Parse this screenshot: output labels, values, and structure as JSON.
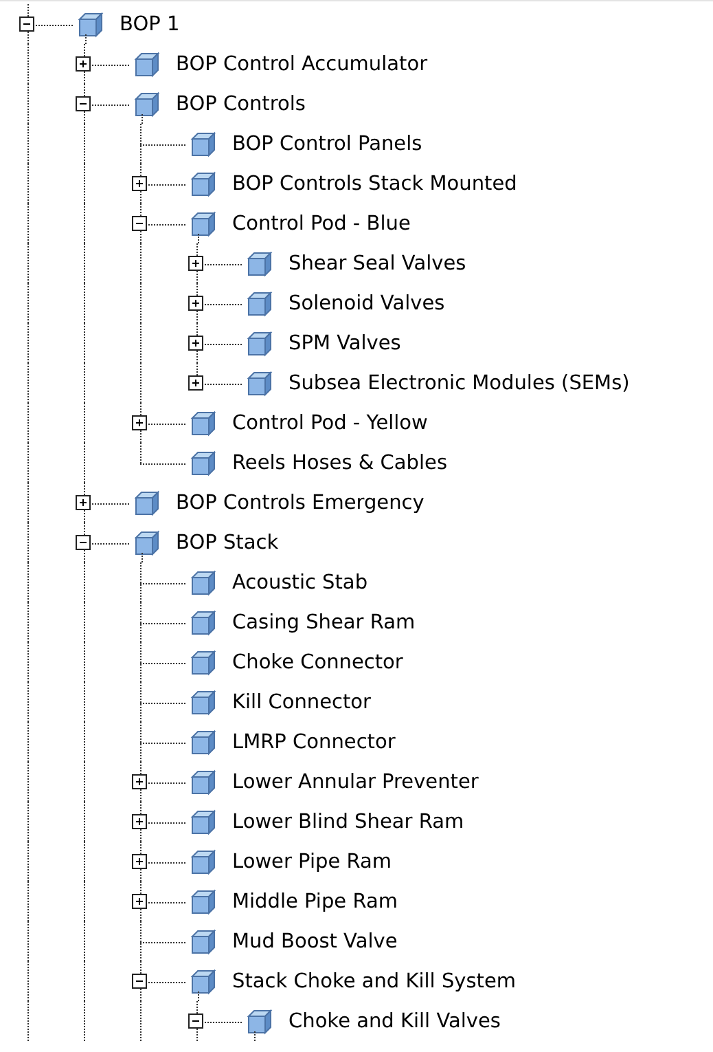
{
  "tree": [
    {
      "label": "BOP 1",
      "expanded": true,
      "children": [
        {
          "label": "BOP Control Accumulator",
          "expanded": false
        },
        {
          "label": "BOP Controls",
          "expanded": true,
          "children": [
            {
              "label": "BOP Control Panels"
            },
            {
              "label": "BOP Controls Stack Mounted",
              "expanded": false
            },
            {
              "label": "Control Pod - Blue",
              "expanded": true,
              "children": [
                {
                  "label": "Shear Seal Valves",
                  "expanded": false
                },
                {
                  "label": "Solenoid Valves",
                  "expanded": false
                },
                {
                  "label": "SPM Valves",
                  "expanded": false
                },
                {
                  "label": "Subsea Electronic Modules (SEMs)",
                  "expanded": false
                }
              ]
            },
            {
              "label": "Control Pod - Yellow",
              "expanded": false
            },
            {
              "label": "Reels Hoses & Cables"
            }
          ]
        },
        {
          "label": "BOP Controls Emergency",
          "expanded": false
        },
        {
          "label": "BOP Stack",
          "expanded": true,
          "children": [
            {
              "label": "Acoustic Stab"
            },
            {
              "label": "Casing Shear Ram"
            },
            {
              "label": "Choke Connector"
            },
            {
              "label": "Kill Connector"
            },
            {
              "label": "LMRP Connector"
            },
            {
              "label": "Lower Annular Preventer",
              "expanded": false
            },
            {
              "label": "Lower Blind Shear Ram",
              "expanded": false
            },
            {
              "label": "Lower Pipe Ram",
              "expanded": false
            },
            {
              "label": "Middle Pipe Ram",
              "expanded": false
            },
            {
              "label": "Mud Boost Valve"
            },
            {
              "label": "Stack Choke and Kill System",
              "expanded": true,
              "children": [
                {
                  "label": "Choke and Kill Valves",
                  "expanded": true
                }
              ]
            }
          ]
        }
      ]
    }
  ]
}
